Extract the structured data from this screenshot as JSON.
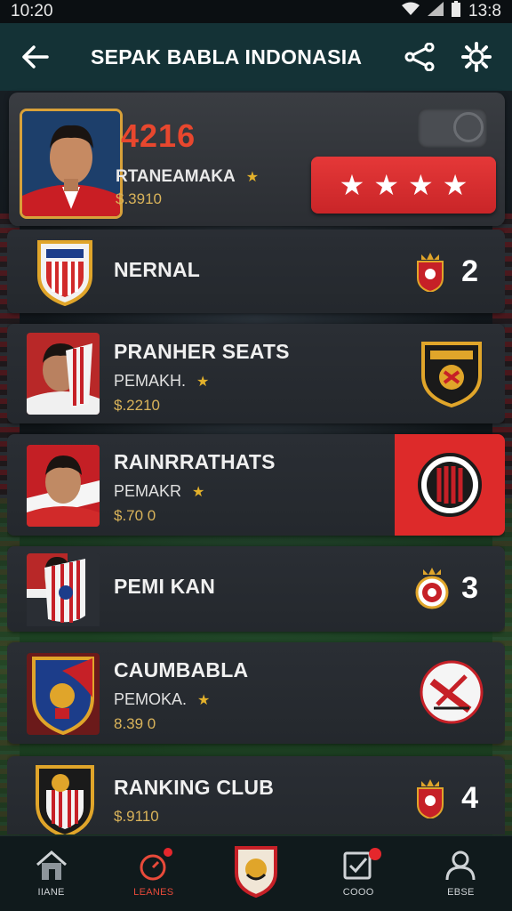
{
  "status_bar": {
    "time": "10:20",
    "right_time": "13:8"
  },
  "app_bar": {
    "title": "SEPAK BABLA INDONASIA"
  },
  "profile": {
    "score": "4216",
    "name": "RTANEAMAKA",
    "price": "$.3910"
  },
  "rows": [
    {
      "title": "NERNAL",
      "rank": "2"
    },
    {
      "title": "PRANHER SEATS",
      "subtitle": "PEMAKH.",
      "price": "$.2210"
    },
    {
      "title": "RAINRRATHATS",
      "subtitle": "PEMAKR",
      "price": "$.70 0"
    },
    {
      "title": "PEMI KAN",
      "rank": "3"
    },
    {
      "title": "CAUMBABLA",
      "subtitle": "PEMOKA.",
      "price": "8.39 0"
    },
    {
      "title": "RANKING CLUB",
      "price": "$.9110",
      "rank": "4"
    }
  ],
  "nav": [
    {
      "label": "IIANE"
    },
    {
      "label": "LEANES"
    },
    {
      "label": ""
    },
    {
      "label": "COOO"
    },
    {
      "label": "EBSE"
    }
  ],
  "colors": {
    "accent_red": "#dd2a2a",
    "score_red": "#e8472e",
    "gold": "#e3b12b",
    "app_bar": "#143236"
  }
}
